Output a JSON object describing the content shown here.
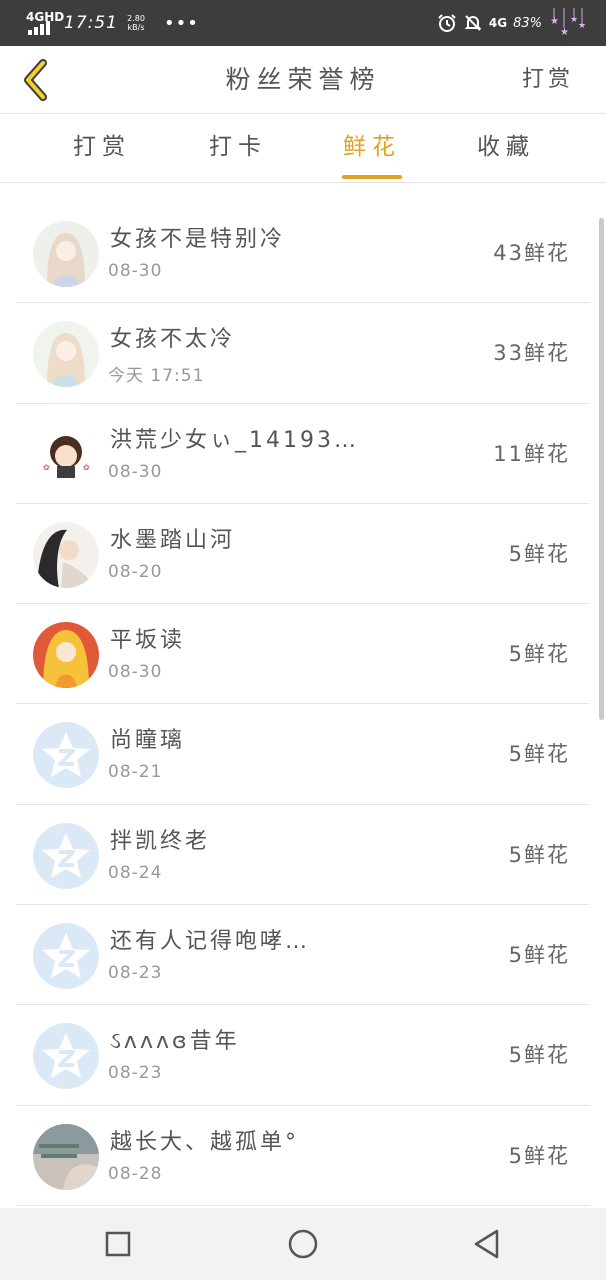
{
  "status_bar": {
    "network": "4GHD",
    "time": "17:51",
    "speed_value": "2.80",
    "speed_unit": "kB/s",
    "more": "•••",
    "network_right": "4G",
    "battery": "83%"
  },
  "header": {
    "title": "粉丝荣誉榜",
    "action": "打赏"
  },
  "tabs": [
    {
      "label": "打赏",
      "active": false
    },
    {
      "label": "打卡",
      "active": false
    },
    {
      "label": "鲜花",
      "active": true
    },
    {
      "label": "收藏",
      "active": false
    }
  ],
  "list": [
    {
      "name": "女孩不是特别冷",
      "date": "08-30",
      "count": "43鲜花",
      "avatar": "anime-girl-light"
    },
    {
      "name": "女孩不太冷",
      "date": "今天 17:51",
      "count": "33鲜花",
      "avatar": "anime-girl-light"
    },
    {
      "name": "洪荒少女ぃ_14193…",
      "date": "08-30",
      "count": "11鲜花",
      "avatar": "chibi-girl"
    },
    {
      "name": "水墨踏山河",
      "date": "08-20",
      "count": "5鲜花",
      "avatar": "ink-painting-figure"
    },
    {
      "name": "平坂读",
      "date": "08-30",
      "count": "5鲜花",
      "avatar": "anime-girl-yellow"
    },
    {
      "name": "尚瞳璃",
      "date": "08-21",
      "count": "5鲜花",
      "avatar": "default-qq-avatar"
    },
    {
      "name": "拌凯终老",
      "date": "08-24",
      "count": "5鲜花",
      "avatar": "default-qq-avatar"
    },
    {
      "name": "还有人记得咆哮…",
      "date": "08-23",
      "count": "5鲜花",
      "avatar": "default-qq-avatar"
    },
    {
      "name": "ઽᴧᴧᴧɞ昔年",
      "date": "08-23",
      "count": "5鲜花",
      "avatar": "default-qq-avatar"
    },
    {
      "name": "越长大、越孤单°",
      "date": "08-28",
      "count": "5鲜花",
      "avatar": "photo-avatar"
    }
  ],
  "nav_bar": {
    "items": [
      "recent-apps",
      "home",
      "back"
    ]
  },
  "colors": {
    "accent": "#e5a11d",
    "status_bar": "#3d3d3d"
  }
}
